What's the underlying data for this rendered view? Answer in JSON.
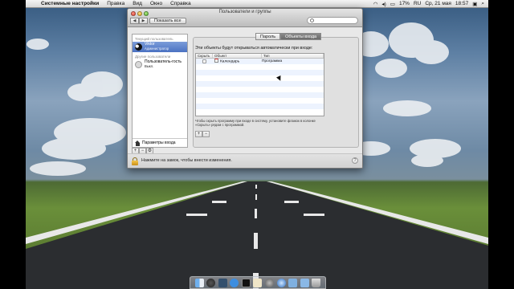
{
  "menubar": {
    "apple": "",
    "items": [
      "Системные настройки",
      "Правка",
      "Вид",
      "Окно",
      "Справка"
    ],
    "right": [
      "17%",
      "RU",
      "Ср, 21 мая",
      "18:57"
    ]
  },
  "window": {
    "title": "Пользователи и группы",
    "nav_back": "◀",
    "nav_forward": "▶",
    "show_all": "Показать все",
    "search_placeholder": ""
  },
  "sidebar": {
    "current_header": "Текущий пользователь",
    "current_user": {
      "name": "Viktor",
      "role": "Администратор"
    },
    "other_header": "Другие пользователи",
    "guest_user": {
      "name": "Пользователь-гость",
      "status": "Выкл."
    },
    "login_options": "Параметры входа",
    "add": "+",
    "remove": "−",
    "action": "⚙"
  },
  "tabs": [
    "Пароль",
    "Объекты входа"
  ],
  "login_items": {
    "caption": "Эти объекты будут открываться автоматически при входе:",
    "columns": [
      "Скрыть",
      "Объект",
      "Тип"
    ],
    "rows": [
      {
        "item": "Календарь",
        "type": "Программа"
      }
    ],
    "hint": "Чтобы скрыть программу при входе в систему, установите флажок в колонке «Скрыть» рядом с программой.",
    "add": "+",
    "remove": "−"
  },
  "lock": {
    "text": "Нажмите на замок, чтобы внести изменения.",
    "help": "?"
  },
  "colors": {
    "selection": "#4b72c2",
    "tab_active": "#7a7a7a",
    "lock": "#e0aa2a"
  }
}
